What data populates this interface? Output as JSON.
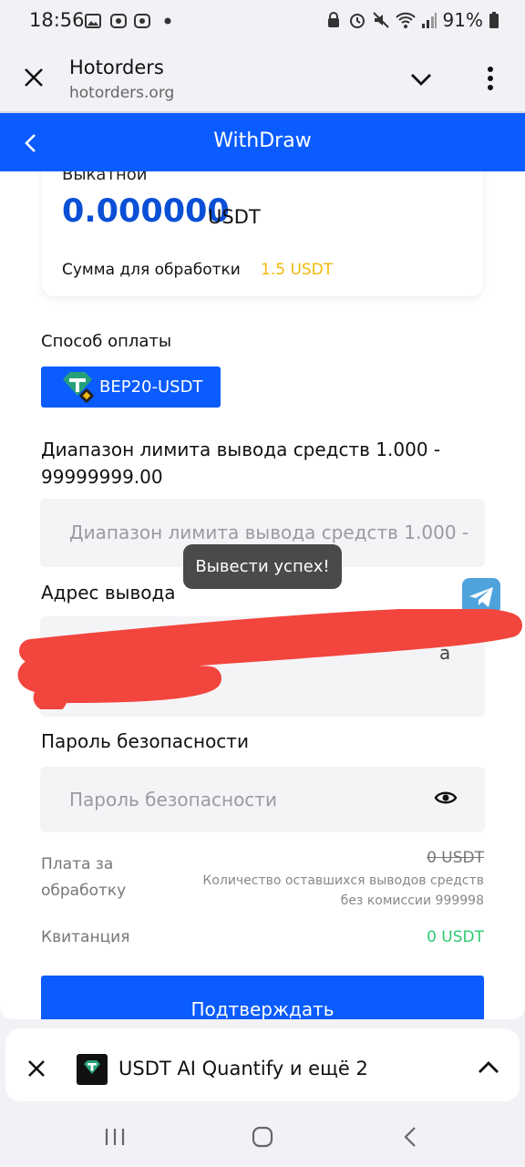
{
  "status": {
    "time": "18:56",
    "battery": "91%"
  },
  "browser": {
    "title": "Hotorders",
    "url": "hotorders.org"
  },
  "header": {
    "title": "WithDraw"
  },
  "balance": {
    "label": "Выкатной",
    "amount": "0.000000",
    "currency": "USDT",
    "processing_label": "Сумма для обработки",
    "processing_value": "1.5 USDT"
  },
  "payment": {
    "label": "Способ оплаты",
    "method": "BEP20-USDT"
  },
  "limit": {
    "label": "Диапазон лимита вывода средств 1.000 - 99999999.00",
    "placeholder": "Диапазон лимита вывода средств 1.000 -"
  },
  "address": {
    "label": "Адрес вывода",
    "placeholder_tail": "а"
  },
  "password": {
    "label": "Пароль безопасности",
    "placeholder": "Пароль безопасности"
  },
  "fee": {
    "label_line1": "Плата за",
    "label_line2": "обработку",
    "strike_value": "0 USDT",
    "note_line1": "Количество оставшихся выводов средств",
    "note_line2": "без комиссии 999998"
  },
  "receipt": {
    "label": "Квитанция",
    "value": "0 USDT"
  },
  "submit": {
    "label": "Подтверждать"
  },
  "toast": {
    "text": "Вывести успех!"
  },
  "tabsheet": {
    "text": "USDT AI Quantify и ещё 2"
  },
  "colors": {
    "brand": "#0a5cff",
    "amount": "#0a4fd6",
    "gold": "#f0b90b",
    "green": "#2ecc71",
    "tether": "#26a17b"
  }
}
